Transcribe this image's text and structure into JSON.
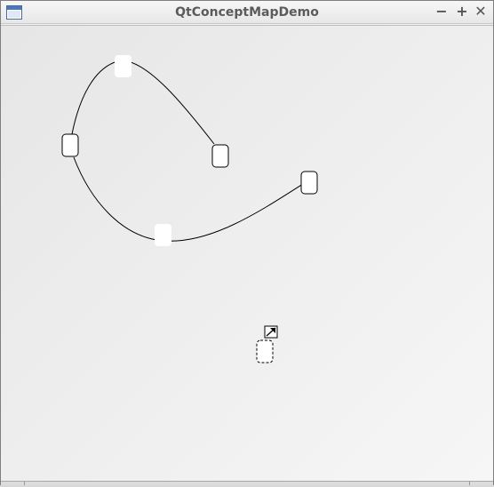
{
  "window": {
    "title": "QtConceptMapDemo",
    "icon": "window-app-icon",
    "controls": {
      "minimize": "−",
      "maximize": "+",
      "close": "✕"
    }
  },
  "concept_map": {
    "nodes": [
      {
        "id": "node-left",
        "style": "solid",
        "selected": false
      },
      {
        "id": "node-top",
        "style": "borderless",
        "selected": false
      },
      {
        "id": "node-mid",
        "style": "solid",
        "selected": false
      },
      {
        "id": "node-bottom",
        "style": "borderless",
        "selected": false
      },
      {
        "id": "node-right",
        "style": "solid",
        "selected": false
      },
      {
        "id": "node-new",
        "style": "dashed",
        "selected": true
      }
    ],
    "edges": [
      {
        "from": "node-left",
        "via": "node-top",
        "to": "node-mid"
      },
      {
        "from": "node-left",
        "via": "node-bottom",
        "to": "node-right"
      }
    ],
    "tool_icon": "resize-arrow-icon",
    "colors": {
      "node_fill": "#ffffff",
      "node_border": "#000000",
      "edge": "#000000"
    }
  }
}
